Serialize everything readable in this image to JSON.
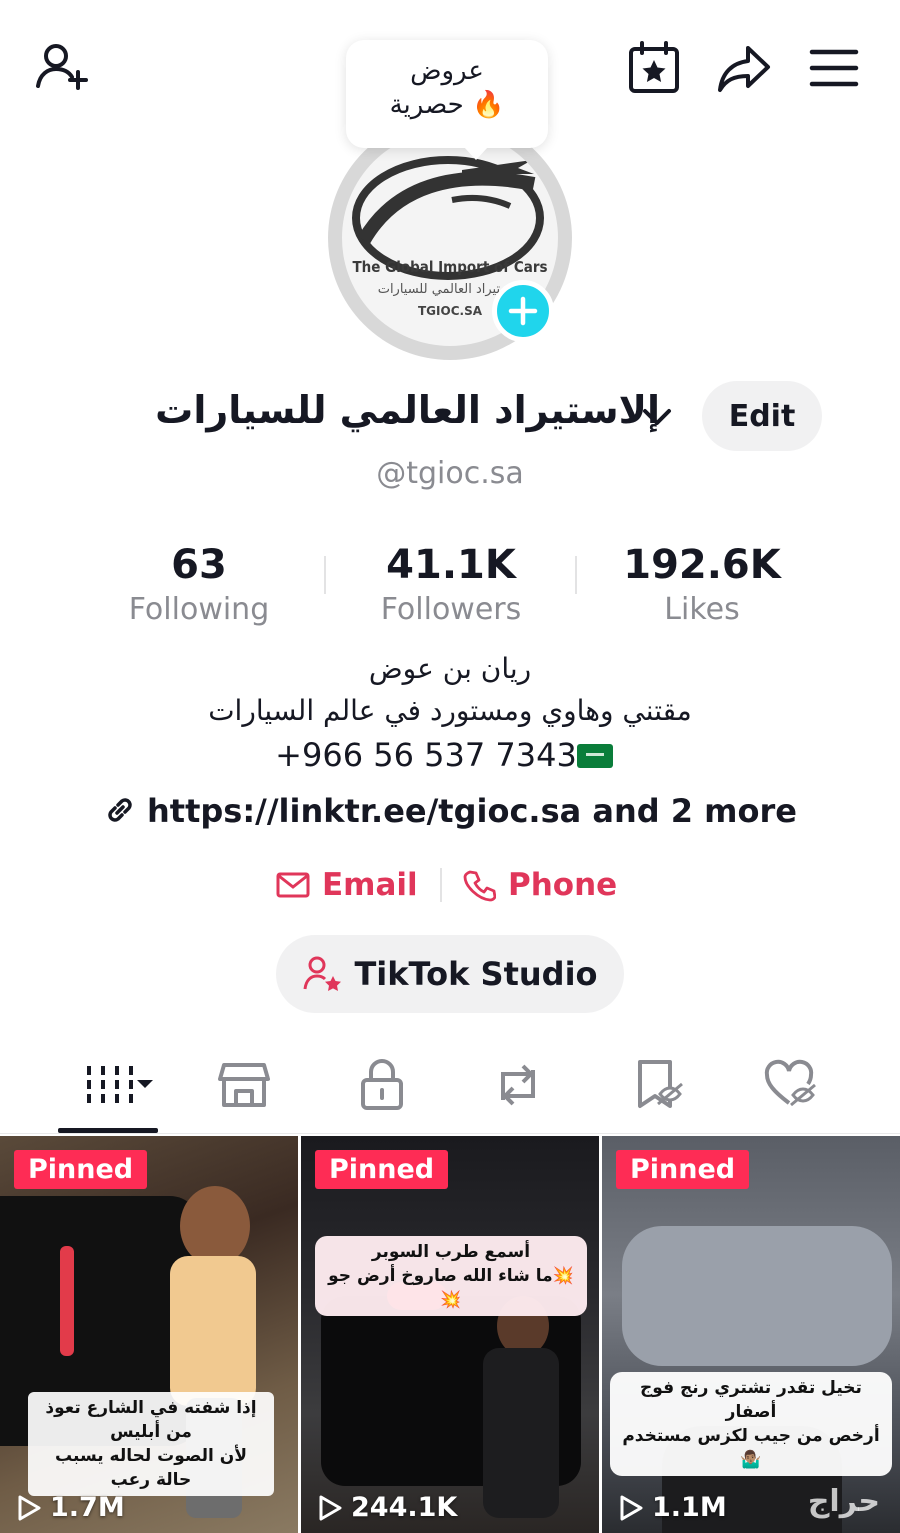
{
  "promo": {
    "line1": "عروض",
    "line2": "حصرية",
    "emoji": "🔥"
  },
  "avatar": {
    "logo_en": "The Global Import of Cars",
    "logo_ar": "الاستيراد العالمي للسيارات",
    "logo_domain": "TGIOC.SA"
  },
  "profile": {
    "name": "إلاستيراد العالمي للسيارات",
    "handle": "@tgioc.sa",
    "edit_label": "Edit"
  },
  "stats": [
    {
      "value": "63",
      "label": "Following"
    },
    {
      "value": "41.1K",
      "label": "Followers"
    },
    {
      "value": "192.6K",
      "label": "Likes"
    }
  ],
  "bio": {
    "line1": "ريان بن عوض",
    "line2": "مقتني وهاوي ومستورد في عالم السيارات",
    "phone": "+966 56 537 7343"
  },
  "link": "https://linktr.ee/tgioc.sa and 2 more",
  "contacts": {
    "email": "Email",
    "phone": "Phone"
  },
  "studio_label": "TikTok Studio",
  "tabs": [
    "grid-icon",
    "shop-icon",
    "lock-icon",
    "repost-icon",
    "favorites-icon",
    "liked-icon"
  ],
  "videos": [
    {
      "badge": "Pinned",
      "views": "1.7M",
      "caption_line1": "إذا شفته في الشارع تعوذ من أبليس",
      "caption_line2": "لأن الصوت لحاله يسبب حالة رعب"
    },
    {
      "badge": "Pinned",
      "views": "244.1K",
      "caption_line1": "أسمع طرب السوبر",
      "caption_line2": "💥ما شاء الله صاروخ أرض جو💥"
    },
    {
      "badge": "Pinned",
      "views": "1.1M",
      "caption_line1": "تخيل تقدر تشتري رنج فوج أصفار",
      "caption_line2": "أرخص من جيب لكزس مستخدم🤷🏽‍♂️"
    }
  ],
  "watermark": "حراج"
}
